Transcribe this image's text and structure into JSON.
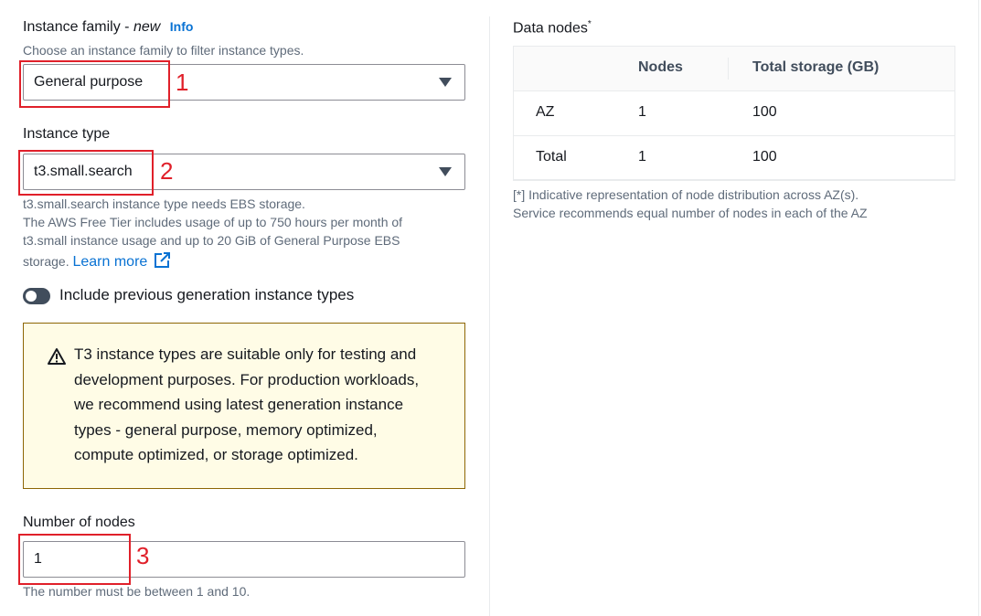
{
  "instance_family": {
    "label": "Instance family - ",
    "label_em": "new",
    "info": "Info",
    "description": "Choose an instance family to filter instance types.",
    "value": "General purpose",
    "annotation": "1"
  },
  "instance_type": {
    "label": "Instance type",
    "value": "t3.small.search",
    "annotation": "2",
    "help_line1": "t3.small.search instance type needs EBS storage.",
    "help_line2": "The AWS Free Tier includes usage of up to 750 hours per month of",
    "help_line3": "t3.small instance usage and up to 20 GiB of General Purpose EBS",
    "help_line4": "storage.",
    "learn_more": "Learn more"
  },
  "previous_gen_toggle": {
    "label": "Include previous generation instance types",
    "checked": false
  },
  "alert": {
    "line1": "T3 instance types are suitable only for testing and",
    "line2": "development purposes. For production workloads,",
    "line3": "we recommend using latest generation instance",
    "line4": "types - general purpose, memory optimized,",
    "line5": "compute optimized, or storage optimized."
  },
  "number_of_nodes": {
    "label": "Number of nodes",
    "value": "1",
    "annotation": "3",
    "help": "The number must be between 1 and 10."
  },
  "data_nodes": {
    "title": "Data nodes",
    "title_sup": "*",
    "columns": [
      "",
      "Nodes",
      "Total storage (GB)"
    ],
    "rows": [
      [
        "AZ",
        "1",
        "100"
      ],
      [
        "Total",
        "1",
        "100"
      ]
    ],
    "footnote_line1": "[*] Indicative representation of node distribution across AZ(s).",
    "footnote_line2": "Service recommends equal number of nodes in each of the AZ"
  },
  "colors": {
    "accent": "#0972d3",
    "annotation_red": "#e0202a",
    "warning_bg": "#fffce6",
    "warning_border": "#8d6605"
  }
}
